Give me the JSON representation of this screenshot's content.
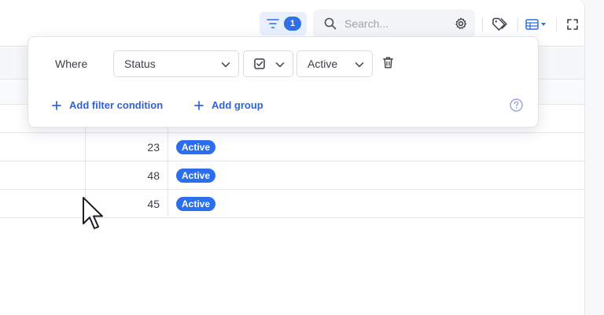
{
  "toolbar": {
    "filter_count": "1",
    "search_placeholder": "Search...",
    "search_value": ""
  },
  "filter": {
    "where_label": "Where",
    "field": "Status",
    "operator_icon": "checkbox-icon",
    "value": "Active",
    "add_condition_label": "Add filter condition",
    "add_group_label": "Add group"
  },
  "rows": [
    {
      "number": "23",
      "status": "Active"
    },
    {
      "number": "48",
      "status": "Active"
    },
    {
      "number": "45",
      "status": "Active"
    }
  ],
  "colors": {
    "accent": "#2f6fe8",
    "badge": "#2b6ef0",
    "link": "#2f63d9"
  }
}
